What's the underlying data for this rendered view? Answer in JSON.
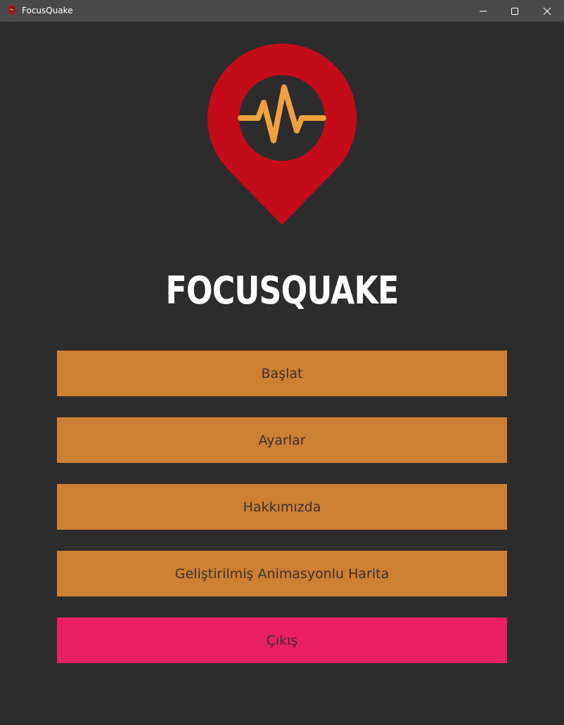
{
  "window": {
    "title": "FocusQuake"
  },
  "icons": {
    "app": "map-pin-pulse-icon",
    "minimize": "minimize-icon",
    "maximize": "maximize-icon",
    "close": "close-icon",
    "logo": "map-pin-pulse-icon"
  },
  "colors": {
    "background": "#2d2c2d",
    "titlebar": "#4a4a4a",
    "pin_red": "#c30b1a",
    "pulse_orange": "#f0a040",
    "button_orange": "#cd7f32",
    "button_exit": "#e91e63"
  },
  "main": {
    "heading": "FOCUSQUAKE",
    "buttons": {
      "start": "Başlat",
      "settings": "Ayarlar",
      "about": "Hakkımızda",
      "map": "Geliştirilmiş Animasyonlu Harita",
      "exit": "Çıkış"
    }
  }
}
